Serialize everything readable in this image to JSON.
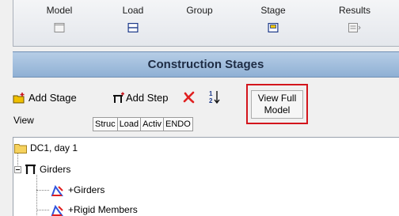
{
  "tabs": [
    {
      "label": "Model",
      "icon": "model-tab-icon"
    },
    {
      "label": "Load",
      "icon": "load-tab-icon"
    },
    {
      "label": "Group",
      "icon": ""
    },
    {
      "label": "Stage",
      "icon": "stage-tab-icon"
    },
    {
      "label": "Results",
      "icon": "results-tab-icon"
    }
  ],
  "section": {
    "title": "Construction Stages"
  },
  "toolbar": {
    "add_stage_label": "Add Stage",
    "add_step_label": "Add Step",
    "view_full_model_label": "View Full Model",
    "view_full_line1": "View Full",
    "view_full_line2": "Model"
  },
  "view": {
    "label": "View",
    "tabs": [
      "Struc",
      "Load",
      "Activ",
      "ENDO"
    ]
  },
  "tree": {
    "root": {
      "label": "DC1, day 1"
    },
    "group": {
      "label": "Girders"
    },
    "children": [
      {
        "label": "+Girders"
      },
      {
        "label": "+Rigid Members"
      }
    ]
  },
  "colors": {
    "header_bg": "#a3bfde",
    "highlight_border": "#d3151c",
    "tab_icon": "#1d3a8a",
    "delete_icon": "#e02020",
    "add_icon": "#f0c000",
    "load_icon": "#3355dd"
  }
}
